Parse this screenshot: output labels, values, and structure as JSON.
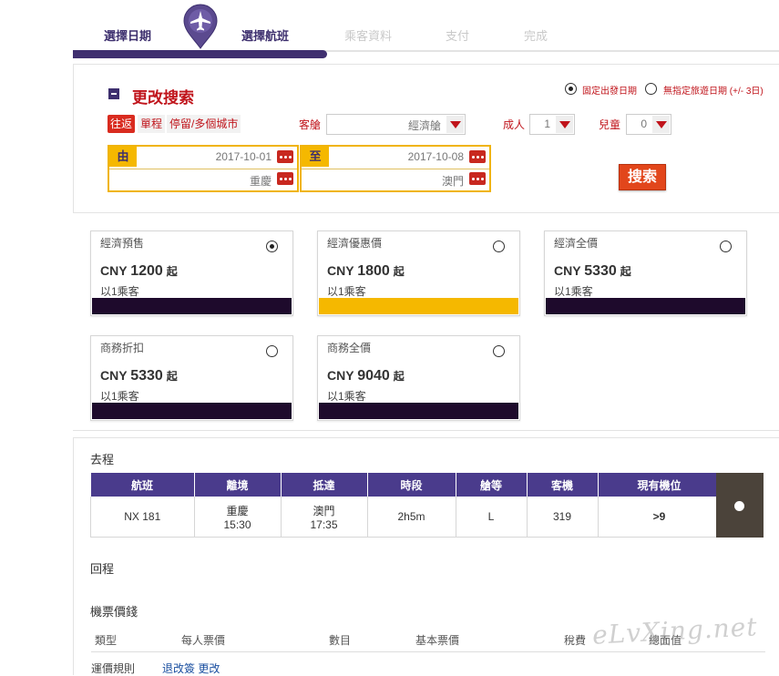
{
  "steps": {
    "items": [
      {
        "label": "選擇日期",
        "state": "done"
      },
      {
        "label": "選擇航班",
        "state": "current"
      },
      {
        "label": "乘客資料",
        "state": "todo"
      },
      {
        "label": "支付",
        "state": "todo"
      },
      {
        "label": "完成",
        "state": "todo"
      }
    ],
    "marker_icon": "airplane-pin-icon",
    "active_color": "#3f2f6f"
  },
  "search": {
    "title": "更改搜索",
    "date_mode": {
      "fixed_label": "固定出發日期",
      "flexible_label": "無指定旅遊日期",
      "flexible_note": "(+/- 3日)",
      "selected": "fixed"
    },
    "trip_types": [
      "往返",
      "單程",
      "停留/多個城市"
    ],
    "trip_type_selected": "往返",
    "cabin": {
      "label": "客艙",
      "value": "經濟艙"
    },
    "adults": {
      "label": "成人",
      "value": "1"
    },
    "children": {
      "label": "兒童",
      "value": "0"
    },
    "from": {
      "tag": "由",
      "date": "2017-10-01",
      "city": "重慶"
    },
    "to": {
      "tag": "至",
      "date": "2017-10-08",
      "city": "澳門"
    },
    "search_button": "搜索",
    "accent_color": "#c0141b"
  },
  "fares": [
    {
      "name": "經濟預售",
      "currency": "CNY",
      "price": "1200",
      "suffix": "起",
      "unit": "以1乘客",
      "selected": true
    },
    {
      "name": "經濟優惠價",
      "currency": "CNY",
      "price": "1800",
      "suffix": "起",
      "unit": "以1乘客",
      "selected": false
    },
    {
      "name": "經濟全價",
      "currency": "CNY",
      "price": "5330",
      "suffix": "起",
      "unit": "以1乘客",
      "selected": false
    },
    {
      "name": "商務折扣",
      "currency": "CNY",
      "price": "5330",
      "suffix": "起",
      "unit": "以1乘客",
      "selected": false
    },
    {
      "name": "商務全價",
      "currency": "CNY",
      "price": "9040",
      "suffix": "起",
      "unit": "以1乘客",
      "selected": false
    }
  ],
  "outbound": {
    "title": "去程",
    "columns": [
      "航班",
      "離境",
      "抵達",
      "時段",
      "艙等",
      "客機",
      "現有機位"
    ],
    "rows": [
      {
        "flight": "NX 181",
        "dep_city": "重慶",
        "dep_time": "15:30",
        "arr_city": "澳門",
        "arr_time": "17:35",
        "duration": "2h5m",
        "class": "L",
        "aircraft": "319",
        "seats": ">9"
      }
    ]
  },
  "return_title": "回程",
  "price_section": {
    "title": "機票價錢",
    "columns": [
      "類型",
      "每人票價",
      "數目",
      "基本票價",
      "稅費",
      "總面值"
    ]
  },
  "cut_off_text": {
    "label": "運價規則",
    "link": "退改簽 更改"
  },
  "watermark": "eLvXing.net"
}
